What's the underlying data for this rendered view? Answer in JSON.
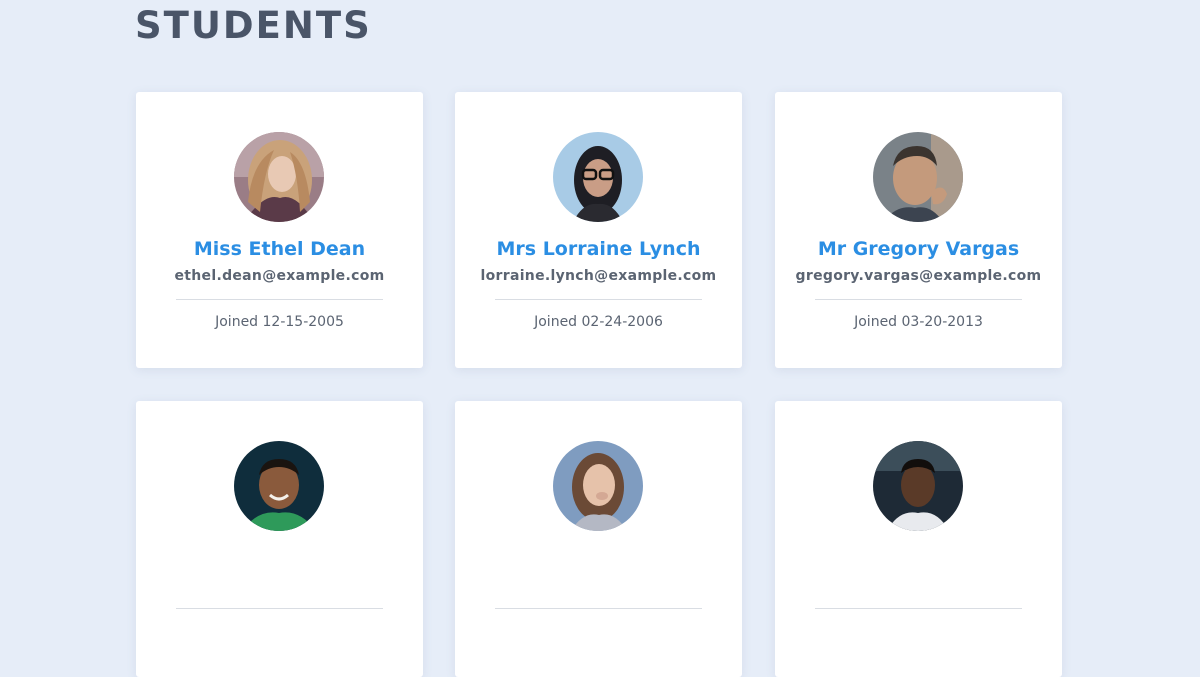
{
  "page": {
    "title": "STUDENTS"
  },
  "students": [
    {
      "name": "Miss Ethel Dean",
      "email": "ethel.dean@example.com",
      "joined": "Joined 12-15-2005"
    },
    {
      "name": "Mrs Lorraine Lynch",
      "email": "lorraine.lynch@example.com",
      "joined": "Joined 02-24-2006"
    },
    {
      "name": "Mr Gregory Vargas",
      "email": "gregory.vargas@example.com",
      "joined": "Joined 03-20-2013"
    },
    {
      "name": "",
      "email": "",
      "joined": ""
    },
    {
      "name": "",
      "email": "",
      "joined": ""
    },
    {
      "name": "",
      "email": "",
      "joined": ""
    }
  ],
  "colors": {
    "background": "#e6edf8",
    "card": "#ffffff",
    "title": "#4a5568",
    "name": "#2b8ee3",
    "text": "#5b6472"
  }
}
